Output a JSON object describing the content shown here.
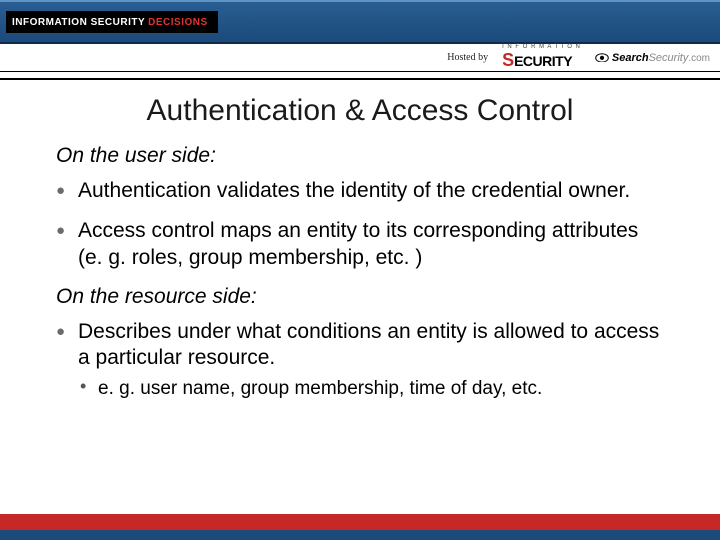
{
  "brand": {
    "a": "INFORMATION SECURITY",
    "b": "DECISIONS"
  },
  "sponsor": {
    "hosted_by": "Hosted by",
    "security_prefix": "I N F O R M A T I O N",
    "security_s": "S",
    "security_word": "ECURITY",
    "search_bold": "Search",
    "search_italic": "Security",
    "search_suffix": ".com"
  },
  "title": "Authentication & Access Control",
  "sections": [
    {
      "heading": "On the user side:",
      "bullets": [
        {
          "text": "Authentication validates the identity of the credential owner."
        },
        {
          "text": "Access control maps an entity to its corresponding attributes (e. g. roles, group membership, etc. )"
        }
      ]
    },
    {
      "heading": "On the resource side:",
      "bullets": [
        {
          "text": "Describes under what conditions an entity is allowed to access a particular resource.",
          "sub": [
            "e. g. user name, group membership, time of day, etc."
          ]
        }
      ]
    }
  ]
}
